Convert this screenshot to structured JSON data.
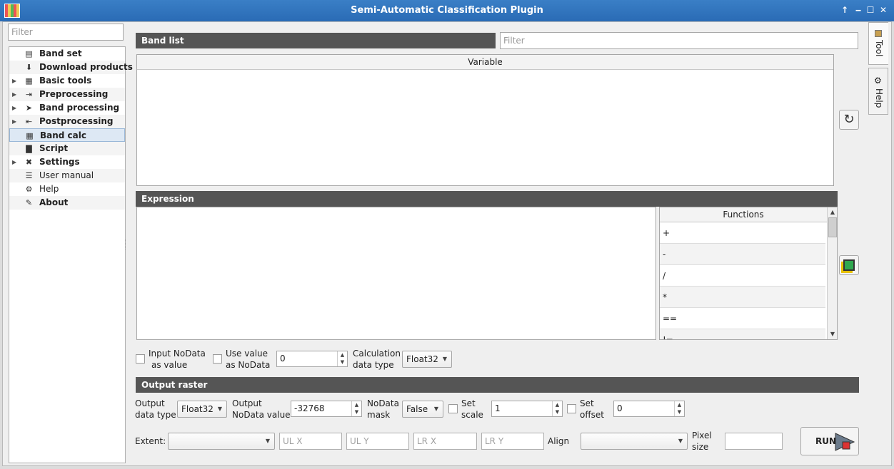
{
  "window": {
    "title": "Semi-Automatic Classification Plugin",
    "controls": [
      "↑",
      "‒",
      "☐",
      "✕"
    ]
  },
  "sidebar": {
    "filter_placeholder": "Filter",
    "items": [
      {
        "label": "Band set",
        "icon": "band-set-icon",
        "glyph": "▤",
        "expandable": false,
        "bold": true
      },
      {
        "label": "Download products",
        "icon": "download-icon",
        "glyph": "⬇",
        "expandable": false,
        "bold": true
      },
      {
        "label": "Basic tools",
        "icon": "basic-tools-icon",
        "glyph": "▦",
        "expandable": true,
        "bold": true
      },
      {
        "label": "Preprocessing",
        "icon": "preprocessing-icon",
        "glyph": "⇥",
        "expandable": true,
        "bold": true
      },
      {
        "label": "Band processing",
        "icon": "band-processing-icon",
        "glyph": "➤",
        "expandable": true,
        "bold": true
      },
      {
        "label": "Postprocessing",
        "icon": "postprocessing-icon",
        "glyph": "⇤",
        "expandable": true,
        "bold": true
      },
      {
        "label": "Band calc",
        "icon": "band-calc-icon",
        "glyph": "▦",
        "expandable": false,
        "bold": true
      },
      {
        "label": "Script",
        "icon": "script-icon",
        "glyph": "▇",
        "expandable": false,
        "bold": true
      },
      {
        "label": "Settings",
        "icon": "settings-icon",
        "glyph": "✖",
        "expandable": true,
        "bold": true
      },
      {
        "label": "User manual",
        "icon": "user-manual-icon",
        "glyph": "☰",
        "expandable": false,
        "bold": false
      },
      {
        "label": "Help",
        "icon": "help-icon",
        "glyph": "⚙",
        "expandable": false,
        "bold": false
      },
      {
        "label": "About",
        "icon": "about-icon",
        "glyph": "✎",
        "expandable": false,
        "bold": true
      }
    ],
    "selected": "Band calc"
  },
  "band_list": {
    "header": "Band list",
    "filter_placeholder": "Filter",
    "column": "Variable"
  },
  "expression": {
    "header": "Expression",
    "functions_header": "Functions",
    "functions": [
      "+",
      "-",
      "/",
      "*",
      "==",
      "!="
    ]
  },
  "options": {
    "input_nodata_label_1": "Input NoData",
    "input_nodata_label_2": "as value",
    "use_value_label_1": "Use value",
    "use_value_label_2": "as NoData",
    "nodata_value": "0",
    "calc_type_label_1": "Calculation",
    "calc_type_label_2": "data type",
    "calc_type_value": "Float32"
  },
  "output_raster": {
    "header": "Output raster",
    "data_type_label_1": "Output",
    "data_type_label_2": "data type",
    "data_type_value": "Float32",
    "nodata_label_1": "Output",
    "nodata_label_2": "NoData value",
    "nodata_value": "-32768",
    "mask_label_1": "NoData",
    "mask_label_2": "mask",
    "mask_value": "False",
    "scale_label_1": "Set",
    "scale_label_2": "scale",
    "scale_value": "1",
    "offset_label_1": "Set",
    "offset_label_2": "offset",
    "offset_value": "0",
    "extent_label": "Extent:",
    "extent_value": "",
    "ulx_placeholder": "UL X",
    "uly_placeholder": "UL Y",
    "lrx_placeholder": "LR X",
    "lry_placeholder": "LR Y",
    "align_label": "Align",
    "align_value": "",
    "pixel_size_label_1": "Pixel",
    "pixel_size_label_2": "size",
    "pixel_size_value": "",
    "run_label": "RUN"
  },
  "side_tabs": [
    {
      "label": "Tool",
      "icon": "tool-icon"
    },
    {
      "label": "Help",
      "icon": "help-tab-icon"
    }
  ],
  "colors": {
    "titlebar": "#2a6bb5",
    "header_bar": "#555555",
    "selection": "#dde8f4"
  }
}
